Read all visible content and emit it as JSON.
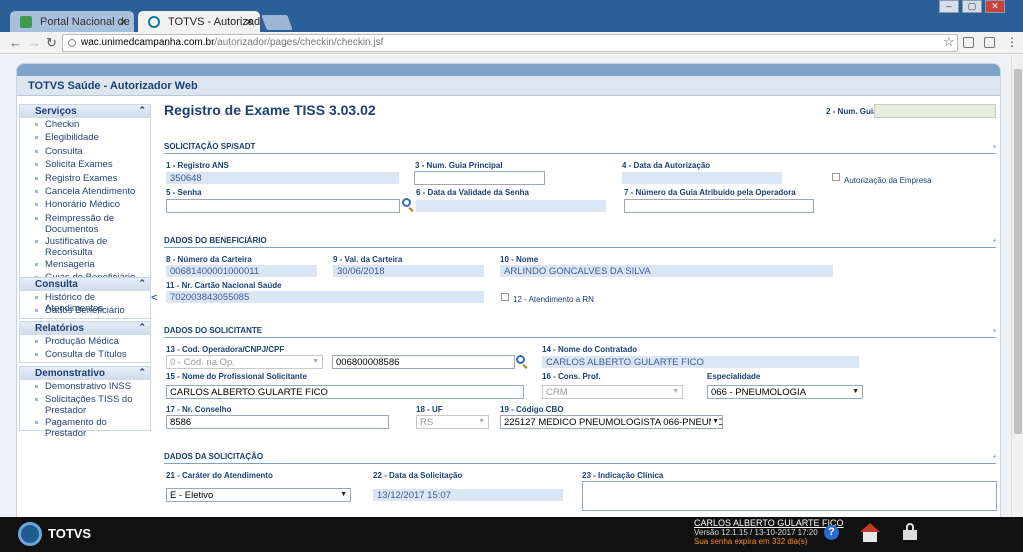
{
  "browser": {
    "tabs": [
      {
        "title": "Portal Nacional de Saúde"
      },
      {
        "title": "TOTVS - Autorizador W"
      }
    ],
    "url_host": "wac.unimedcampanha.com.br",
    "url_path": "/autorizador/pages/checkin/checkin.jsf",
    "window_controls": [
      "–",
      "▢",
      "✕"
    ]
  },
  "app": {
    "title": "TOTVS Saúde - Autorizador Web"
  },
  "sidebar": {
    "collapse_glyph": "<",
    "groups": [
      {
        "title": "Serviços",
        "items": [
          "Checkin",
          "Elegibilidade",
          "Consulta",
          "Solicita Exames",
          "Registro Exames",
          "Cancela Atendimento",
          "Honorário Médico",
          "Reimpressão de Documentos",
          "Justificativa de Reconsulta",
          "Mensageria",
          "Guias do Beneficiário"
        ]
      },
      {
        "title": "Consulta",
        "items": [
          "Histórico de Atendimentos",
          "Dados Beneficiário"
        ]
      },
      {
        "title": "Relatórios",
        "items": [
          "Produção Médica",
          "Consulta de Títulos"
        ]
      },
      {
        "title": "Demonstrativo",
        "items": [
          "Demonstrativo INSS",
          "Solicitações TISS do Prestador",
          "Pagamento do Prestador"
        ]
      }
    ]
  },
  "page": {
    "title": "Registro de Exame TISS 3.03.02",
    "num_guia_label": "2 - Num. Guia",
    "num_guia_value": ""
  },
  "sections": {
    "solicitacao": "SOLICITAÇÃO SP/SADT",
    "beneficiario": "DADOS DO BENEFICIÁRIO",
    "solicitante": "DADOS DO SOLICITANTE",
    "da_solicitacao": "DADOS DA SOLICITAÇÃO"
  },
  "fields": {
    "registro_ans": {
      "label": "1 - Registro ANS",
      "value": "350648"
    },
    "guia_principal": {
      "label": "3 - Num. Guia Principal",
      "value": ""
    },
    "data_autorizacao": {
      "label": "4 - Data da Autorização",
      "value": ""
    },
    "autorizacao_empresa": {
      "label": "Autorização da Empresa",
      "checked": false
    },
    "senha": {
      "label": "5 - Senha",
      "value": ""
    },
    "validade_senha": {
      "label": "6 - Data da Validade da Senha",
      "value": ""
    },
    "guia_operadora": {
      "label": "7 - Número da Guia Atribuído pela Operadora",
      "value": ""
    },
    "carteira": {
      "label": "8 - Número da Carteira",
      "value": "00681400001000011"
    },
    "val_carteira": {
      "label": "9 - Val. da Carteira",
      "value": "30/06/2018"
    },
    "nome": {
      "label": "10 - Nome",
      "value": "ARLINDO GONCALVES DA SILVA"
    },
    "cns": {
      "label": "11 - Nr. Cartão Nacional Saúde",
      "value": "702003843055085"
    },
    "atendimento_rn": {
      "label": "12 - Atendimento a RN",
      "checked": false
    },
    "cod_operadora": {
      "label": "13 - Cod. Operadora/CNPJ/CPF",
      "select_value": "0 - Cód. na Op.",
      "value": "006800008586"
    },
    "nome_contratado": {
      "label": "14 - Nome do Contratado",
      "value": "CARLOS ALBERTO GULARTE FICO"
    },
    "profissional": {
      "label": "15 - Nome do Profissional Solicitante",
      "value": "CARLOS ALBERTO GULARTE FICO"
    },
    "cons_prof": {
      "label": "16 - Cons. Prof.",
      "value": "CRM"
    },
    "especialidade": {
      "label": "Especialidade",
      "value": "066 - PNEUMOLOGIA"
    },
    "nr_conselho": {
      "label": "17 - Nr. Conselho",
      "value": "8586"
    },
    "uf": {
      "label": "18 - UF",
      "value": "RS"
    },
    "cbo": {
      "label": "19 - Código CBO",
      "value": "225127 MEDICO PNEUMOLOGISTA 066-PNEUMOLOGIA"
    },
    "carater": {
      "label": "21 - Caráter do Atendimento",
      "value": "E - Eletivo"
    },
    "data_solicitacao": {
      "label": "22 - Data da Solicitação",
      "value": "13/12/2017 15:07"
    },
    "indicacao": {
      "label": "23 - Indicação Clínica",
      "value": ""
    }
  },
  "footer": {
    "brand": "TOTVS",
    "user": "CARLOS ALBERTO GULARTE FICO",
    "version": "Versão 12.1.15 / 13-10-2017 17:20",
    "expire": "Sua senha expira em 332 dia(s)",
    "help": "?"
  }
}
